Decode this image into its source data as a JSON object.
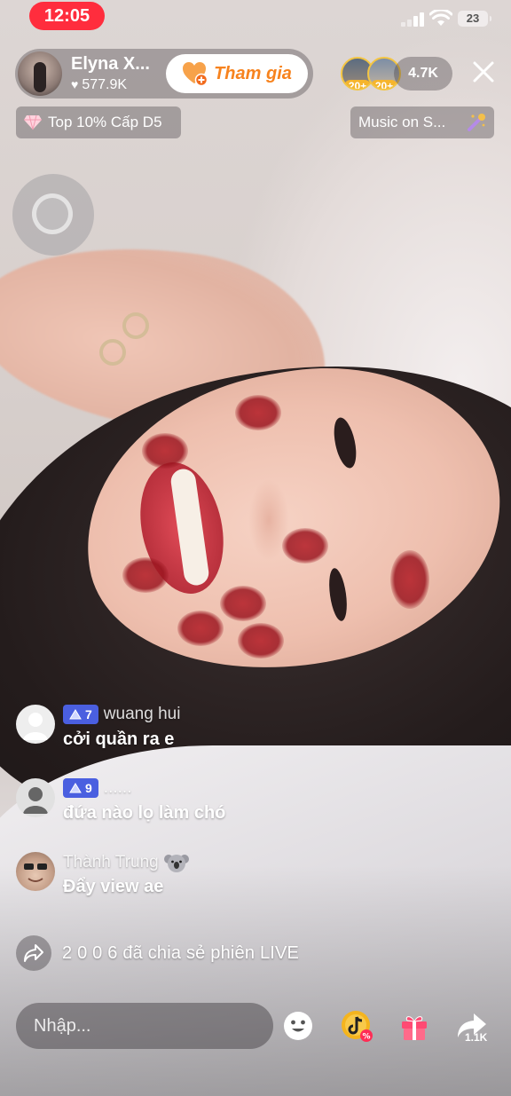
{
  "status_bar": {
    "time": "12:05",
    "battery": "23"
  },
  "host": {
    "name": "Elyna X...",
    "likes": "577.9K",
    "join_label": "Tham gia"
  },
  "viewers": {
    "avatar_badges": [
      "20+",
      "20+"
    ],
    "count": "4.7K"
  },
  "rank_badge": "Top 10% Cấp D5",
  "music": "Music on S...",
  "comments": [
    {
      "level": "7",
      "user": "wuang hui",
      "text": "cởi quần ra e"
    },
    {
      "level": "9",
      "user": "......",
      "text": "đứa nào lọ làm chó"
    },
    {
      "user": "Thành Trung",
      "text": "Đẩy view ae"
    }
  ],
  "share_note": "2 0 0 6 đã chia sẻ phiên LIVE",
  "bottom_bar": {
    "input_placeholder": "Nhập...",
    "share_count": "1.1K"
  },
  "colors": {
    "time_pill": "#ff2d3d",
    "join_text": "#f7831e",
    "level_badge": "#4a5fe0",
    "gift": "#ff4a73"
  }
}
